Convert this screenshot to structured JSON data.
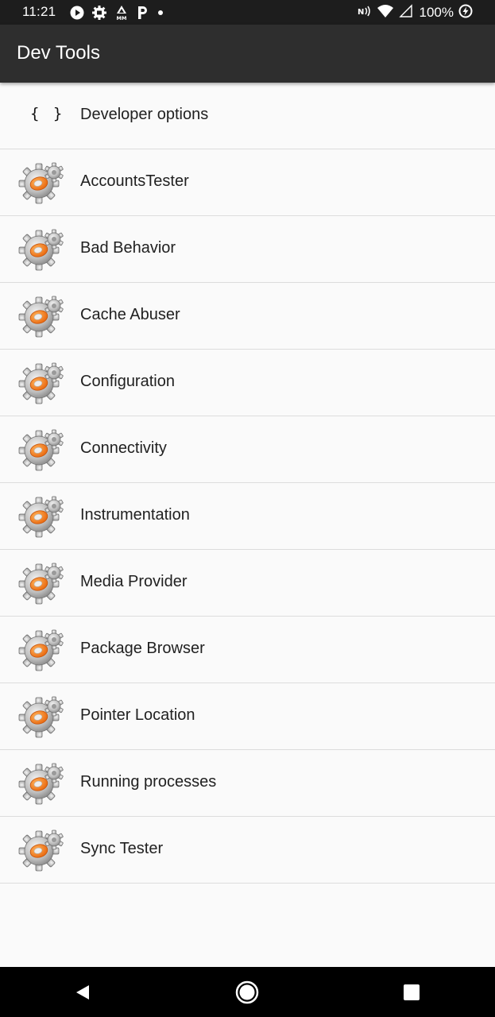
{
  "status_bar": {
    "time": "11:21",
    "battery": "100%",
    "notification_icons": [
      "play-icon",
      "settings-notification-icon",
      "mm-icon",
      "parking-icon",
      "dot-icon"
    ],
    "right_icons": [
      "nfc-icon",
      "wifi-icon",
      "signal-icon",
      "battery-charging-icon"
    ]
  },
  "app_bar": {
    "title": "Dev Tools"
  },
  "list": {
    "items": [
      {
        "label": "Developer options",
        "icon": "braces-icon",
        "glyph": "{ }"
      },
      {
        "label": "AccountsTester",
        "icon": "gear-icon"
      },
      {
        "label": "Bad Behavior",
        "icon": "gear-icon"
      },
      {
        "label": "Cache Abuser",
        "icon": "gear-icon"
      },
      {
        "label": "Configuration",
        "icon": "gear-icon"
      },
      {
        "label": "Connectivity",
        "icon": "gear-icon"
      },
      {
        "label": "Instrumentation",
        "icon": "gear-icon"
      },
      {
        "label": "Media Provider",
        "icon": "gear-icon"
      },
      {
        "label": "Package Browser",
        "icon": "gear-icon"
      },
      {
        "label": "Pointer Location",
        "icon": "gear-icon"
      },
      {
        "label": "Running processes",
        "icon": "gear-icon"
      },
      {
        "label": "Sync Tester",
        "icon": "gear-icon"
      }
    ]
  },
  "nav_bar": {
    "buttons": [
      "back-icon",
      "home-icon",
      "recents-icon"
    ]
  },
  "colors": {
    "status_bar_bg": "#1d1d1d",
    "app_bar_bg": "#2e2e2e",
    "list_bg": "#fafafa",
    "divider": "#dcdcdc",
    "gear_accent": "#f07b1d",
    "nav_bar_bg": "#000000"
  }
}
